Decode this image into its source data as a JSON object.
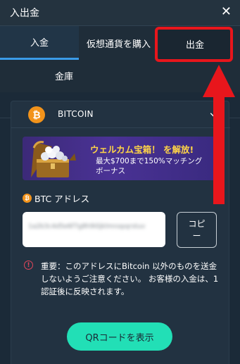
{
  "header": {
    "title": "入出金",
    "close_icon": "close-icon"
  },
  "tabs": [
    {
      "label": "入金",
      "active": true
    },
    {
      "label": "仮想通貨を購入",
      "active": false
    },
    {
      "label": "出金",
      "active": false
    },
    {
      "label": "金庫",
      "active": false
    }
  ],
  "coin": {
    "name": "BITCOIN",
    "icon_symbol": "₿",
    "expand_icon": "chevron-down-icon"
  },
  "promo": {
    "line1": "ウェルカム宝箱！ を解放!",
    "line2": "最大$700まで150%マッチング",
    "line3": "ボーナス"
  },
  "address": {
    "label": "BTC アドレス",
    "value": "1a2b3c4d5e6f7g8h9i0jklmnopqrstuv",
    "copy_label_1": "コピ",
    "copy_label_2": "ー"
  },
  "notice": {
    "icon_symbol": "!",
    "text": "重要：このアドレスにBitcoin 以外のものを送金しないようご注意ください。 お客様の入金は、1 認証後に反映されます。"
  },
  "qr_button": {
    "label": "QRコードを表示"
  },
  "colors": {
    "background": "#1b2a38",
    "accent_tab": "#3a9be8",
    "highlight_red": "#e8161c",
    "qr_button": "#22dfb6",
    "btc_orange": "#f2931b",
    "promo_yellow": "#ffd447",
    "warning_red": "#e0465a"
  }
}
